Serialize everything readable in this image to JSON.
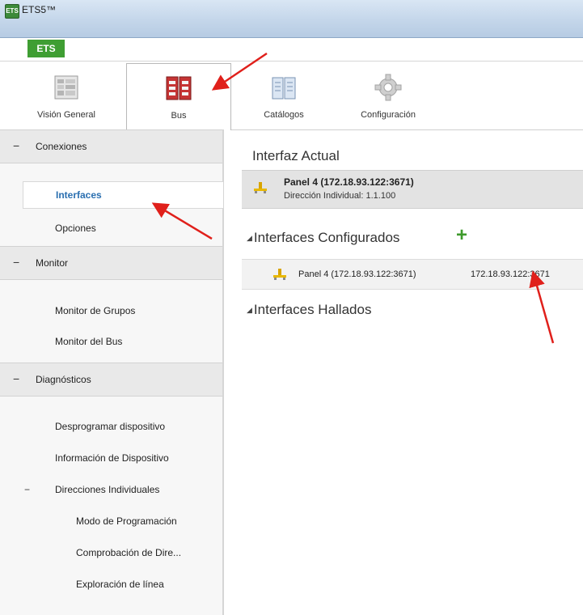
{
  "window": {
    "title": "ETS5™",
    "logo_text": "ETS"
  },
  "app_tab": {
    "label": "ETS"
  },
  "ribbon": {
    "tabs": [
      {
        "label": "Visión General",
        "icon": "overview-icon",
        "active": false
      },
      {
        "label": "Bus",
        "icon": "bus-icon",
        "active": true
      },
      {
        "label": "Catálogos",
        "icon": "catalog-icon",
        "active": false
      },
      {
        "label": "Configuración",
        "icon": "settings-gear-icon",
        "active": false
      }
    ]
  },
  "sidebar": {
    "sections": [
      {
        "toggle": "−",
        "title": "Conexiones",
        "items": [
          "Interfaces",
          "Opciones"
        ],
        "selected": "Interfaces"
      },
      {
        "toggle": "−",
        "title": "Monitor",
        "items": [
          "Monitor de Grupos",
          "Monitor del Bus"
        ]
      },
      {
        "toggle": "−",
        "title": "Diagnósticos",
        "items": [
          "Desprogramar dispositivo",
          "Información de Dispositivo"
        ],
        "group": {
          "toggle": "−",
          "title": "Direcciones Individuales",
          "items": [
            "Modo de Programación",
            "Comprobación de Dire...",
            "Exploración de línea"
          ]
        }
      }
    ]
  },
  "main": {
    "current_heading": "Interfaz Actual",
    "current": {
      "name": "Panel 4 (172.18.93.122:3671)",
      "address": "Dirección Individual: 1.1.100"
    },
    "configured_heading": "Interfaces Configurados",
    "add_label": "+",
    "configured": [
      {
        "name": "Panel 4 (172.18.93.122:3671)",
        "ip": "172.18.93.122:3671"
      }
    ],
    "found_heading": "Interfaces Hallados"
  },
  "colors": {
    "accent_green": "#3f9e33",
    "selected_link": "#2a6fb0",
    "arrow": "#e0201b"
  }
}
